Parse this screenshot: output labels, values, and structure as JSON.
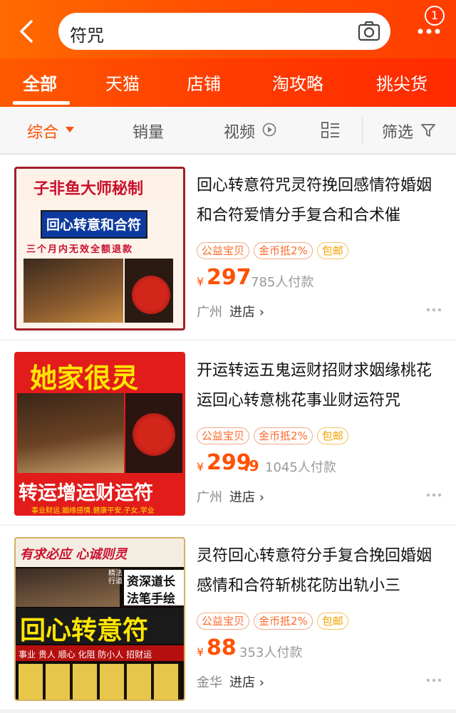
{
  "header": {
    "search_query": "符咒",
    "badge_count": "1",
    "icons": {
      "back": "back-icon",
      "camera": "camera-icon",
      "more": "more-icon"
    }
  },
  "tabs": [
    {
      "label": "全部",
      "active": true
    },
    {
      "label": "天猫"
    },
    {
      "label": "店铺"
    },
    {
      "label": "淘攻略"
    },
    {
      "label": "挑尖货"
    }
  ],
  "filters": {
    "sort": "综合",
    "sales": "销量",
    "video": "视频",
    "filter": "筛选"
  },
  "products": [
    {
      "title": "回心转意符咒灵符挽回感情符婚姻和合符爱情分手复合和合术催",
      "tags": [
        "公益宝贝",
        "金币抵2%",
        "包邮"
      ],
      "price_symbol": "¥",
      "price": "297",
      "paid": "785人付款",
      "location": "广州",
      "enter_shop": "进店 ›",
      "image_text": {
        "line1": "子非鱼大师秘制",
        "line2": "回心转意和合符",
        "line3": "三个月内无效全额退款"
      }
    },
    {
      "title": "开运转运五鬼运财招财求姻缘桃花运回心转意桃花事业财运符咒",
      "tags": [
        "公益宝贝",
        "金币抵2%",
        "包邮"
      ],
      "price_symbol": "¥",
      "price_int": "299",
      "price_dec": ".9",
      "paid": "1045人付款",
      "location": "广州",
      "enter_shop": "进店 ›",
      "image_text": {
        "line1": "她家很灵",
        "line2": "转运增运财运符",
        "line3": "事业财运.姻缘感情.健康平安.子女.学业"
      }
    },
    {
      "title": "灵符回心转意符分手复合挽回婚姻感情和合符斩桃花防出轨小三",
      "tags": [
        "公益宝贝",
        "金币抵2%",
        "包邮"
      ],
      "price_symbol": "¥",
      "price": "88",
      "paid": "353人付款",
      "location": "金华",
      "enter_shop": "进店 ›",
      "image_text": {
        "line1": "有求必应 心诚则灵",
        "line2": "精法行道",
        "line3": "资深道长",
        "line4": "法笔手绘",
        "line5": "回心转意符",
        "line6": "事业 贵人 顺心 化阻 防小人 招财运"
      }
    }
  ],
  "colors": {
    "accent": "#ff5000",
    "tag_orange": "#ff6a2a",
    "tag_yellow": "#f3a100"
  }
}
